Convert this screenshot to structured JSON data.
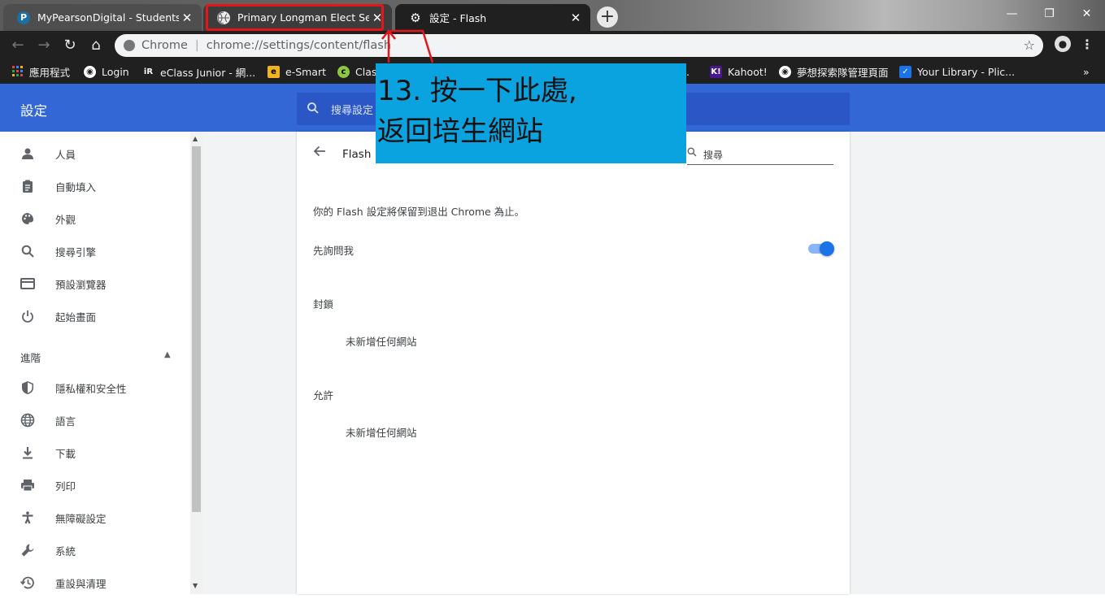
{
  "browser": {
    "tabs": [
      {
        "title": "MyPearsonDigital - Students - ",
        "favicon": "pearson-p-icon",
        "favicon_text": "P"
      },
      {
        "title": "Primary Longman Elect Self-Lea",
        "favicon": "globe-icon",
        "favicon_text": "🌐"
      },
      {
        "title": "設定 - Flash",
        "favicon": "gear-icon",
        "favicon_text": "⚙"
      }
    ],
    "close_glyph": "✕",
    "new_tab_glyph": "+",
    "window_controls": {
      "minimize": "—",
      "restore": "❐",
      "close": "✕"
    },
    "omnibox": {
      "origin": "Chrome",
      "separator": "|",
      "url": "chrome://settings/content/flash"
    },
    "nav": {
      "back": "←",
      "forward": "→",
      "reload": "↻",
      "home": "⌂",
      "star": "☆",
      "menu": "⋮",
      "account": "👤"
    },
    "bookmarks": [
      {
        "label": "應用程式",
        "icon": "apps-grid-icon"
      },
      {
        "label": "Login",
        "icon": "globe-icon"
      },
      {
        "label": "eClass Junior - 網...",
        "icon": "eclass-icon"
      },
      {
        "label": "e-Smart",
        "icon": "esmart-icon"
      },
      {
        "label": "Clas",
        "icon": "class-icon"
      },
      {
        "label": ".",
        "icon": ""
      },
      {
        "label": "Kahoot!",
        "icon": "kahoot-icon"
      },
      {
        "label": "夢想探索隊管理頁面",
        "icon": "globe-icon"
      },
      {
        "label": "Your Library - Plic...",
        "icon": "checkbox-icon"
      }
    ],
    "bookmarks_overflow": "»"
  },
  "settings": {
    "header_title": "設定",
    "search_placeholder": "搜尋設定",
    "sidebar": [
      {
        "label": "人員",
        "icon": "person-icon",
        "glyph": "👤"
      },
      {
        "label": "自動填入",
        "icon": "clipboard-icon",
        "glyph": "📋"
      },
      {
        "label": "外觀",
        "icon": "palette-icon",
        "glyph": "🎨"
      },
      {
        "label": "搜尋引擎",
        "icon": "search-icon",
        "glyph": "🔍"
      },
      {
        "label": "預設瀏覽器",
        "icon": "browser-icon",
        "glyph": "▭"
      },
      {
        "label": "起始畫面",
        "icon": "power-icon",
        "glyph": "⏻"
      }
    ],
    "advanced_label": "進階",
    "advanced_arrow": "▲",
    "advanced_items": [
      {
        "label": "隱私權和安全性",
        "icon": "shield-icon",
        "glyph": "🛡"
      },
      {
        "label": "語言",
        "icon": "globe-icon",
        "glyph": "🌐"
      },
      {
        "label": "下載",
        "icon": "download-icon",
        "glyph": "⬇"
      },
      {
        "label": "列印",
        "icon": "printer-icon",
        "glyph": "🖶"
      },
      {
        "label": "無障礙設定",
        "icon": "accessibility-icon",
        "glyph": "♿"
      },
      {
        "label": "系統",
        "icon": "wrench-icon",
        "glyph": "🔧"
      },
      {
        "label": "重設與清理",
        "icon": "history-icon",
        "glyph": "⟲"
      }
    ],
    "page": {
      "title": "Flash",
      "search_placeholder": "搜尋",
      "notice": "你的 Flash 設定將保留到退出 Chrome 為止。",
      "ask_first_label": "先詢問我",
      "ask_first_enabled": true,
      "block_header": "封鎖",
      "block_empty": "未新增任何網站",
      "allow_header": "允許",
      "allow_empty": "未新增任何網站"
    }
  },
  "annotation": {
    "line1": "13. 按一下此處,",
    "line2": "返回培生網站",
    "highlight_color": "#e5161b",
    "callout_color": "#0aa3e0"
  }
}
